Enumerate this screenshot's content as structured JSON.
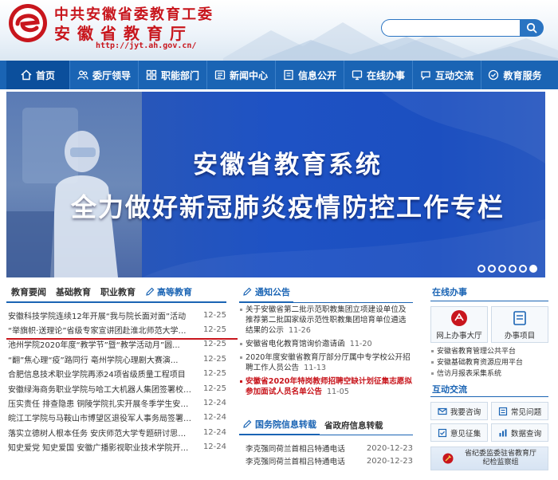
{
  "header": {
    "org_name_line1": "中共安徽省委教育工委",
    "org_name_line2": "安徽省教育厅",
    "url": "http://jyt.ah.gov.cn/",
    "search": {
      "placeholder": "",
      "value": ""
    }
  },
  "nav": {
    "items": [
      {
        "label": "首页",
        "icon": "home-icon"
      },
      {
        "label": "委厅领导",
        "icon": "leaders-icon"
      },
      {
        "label": "职能部门",
        "icon": "departments-icon"
      },
      {
        "label": "新闻中心",
        "icon": "news-icon"
      },
      {
        "label": "信息公开",
        "icon": "info-icon"
      },
      {
        "label": "在线办事",
        "icon": "online-service-icon"
      },
      {
        "label": "互动交流",
        "icon": "chat-icon"
      },
      {
        "label": "教育服务",
        "icon": "education-icon"
      }
    ],
    "active_index": 0
  },
  "banner": {
    "line1": "安徽省教育系统",
    "line2": "全力做好新冠肺炎疫情防控工作专栏",
    "slide_count": 6,
    "active_slide": 5
  },
  "news": {
    "tabs": [
      "教育要闻",
      "基础教育",
      "职业教育",
      "高等教育"
    ],
    "active_tab": 3,
    "items": [
      {
        "title": "安徽科技学院连续12年开展“我与院长面对面”活动",
        "date": "12-25"
      },
      {
        "title": "“举旗帜·送理论”省级专家宣讲团赴淮北师范大学宣...",
        "date": "12-25"
      },
      {
        "title": "池州学院2020年度“教学节”暨“教学活动月”圆...",
        "date": "12-25"
      },
      {
        "title": "“翻”焦心理“疫”路同行  亳州学院心理剧大赛演...",
        "date": "12-25"
      },
      {
        "title": "合肥信息技术职业学院再添24项省级质量工程项目",
        "date": "12-25"
      },
      {
        "title": "安徽绿海商务职业学院与哈工大机器人集团签署校企...",
        "date": "12-25"
      },
      {
        "title": "压实责任  排查隐患  铜陵学院扎实开展冬季学生安全...",
        "date": "12-24"
      },
      {
        "title": "皖江工学院与马鞍山市博望区退役军人事务局签署共...",
        "date": "12-24"
      },
      {
        "title": "落实立德树人根本任务  安庆师范大学专题研讨思政课...",
        "date": "12-24"
      },
      {
        "title": "知史爱党  知史爱国  安徽广播影视职业技术学院开展...",
        "date": "12-24"
      }
    ]
  },
  "notices": {
    "title": "通知公告",
    "items": [
      {
        "title": "关于安徽省第二批示范职教集团立项建设单位及推荐第二批国家级示范性职教集团培育单位遴选结果的公示",
        "date": "11-26",
        "highlight": false
      },
      {
        "title": "安徽省电化教育馆询价邀请函",
        "date": "11-20",
        "highlight": false
      },
      {
        "title": "2020年度安徽省教育厅部分厅属中专学校公开招聘工作人员公告",
        "date": "11-13",
        "highlight": false
      },
      {
        "title": "安徽省2020年特岗教师招聘空缺计划征集志愿拟参加面试人员名单公告",
        "date": "11-05",
        "highlight": true
      }
    ]
  },
  "gov": {
    "tabs": [
      "国务院信息转载",
      "省政府信息转载"
    ],
    "active_tab": 0,
    "items": [
      {
        "title": "李克强同荷兰首相吕特通电话",
        "date": "2020-12-23"
      },
      {
        "title": "李克强同荷兰首相吕特通电话",
        "date": "2020-12-23"
      }
    ]
  },
  "service": {
    "title": "在线办事",
    "tiles": [
      {
        "label": "网上办事大厅",
        "icon": "online-hall-icon"
      },
      {
        "label": "办事项目",
        "icon": "service-items-icon"
      }
    ],
    "links": [
      "安徽省教育管理公共平台",
      "安徽基础教育资源应用平台",
      "信访月报表采集系统"
    ],
    "interact_title": "互动交流",
    "interact_buttons": [
      {
        "label": "我要咨询",
        "icon": "consult-icon"
      },
      {
        "label": "常见问题",
        "icon": "faq-icon"
      },
      {
        "label": "意见征集",
        "icon": "opinion-icon"
      },
      {
        "label": "数据查询",
        "icon": "data-query-icon"
      }
    ],
    "discipline_text_line1": "省纪委监委驻省教育厅",
    "discipline_text_line2": "纪检监察组"
  },
  "colors": {
    "brand_red": "#c8161d",
    "nav_blue": "#1a64b4"
  }
}
